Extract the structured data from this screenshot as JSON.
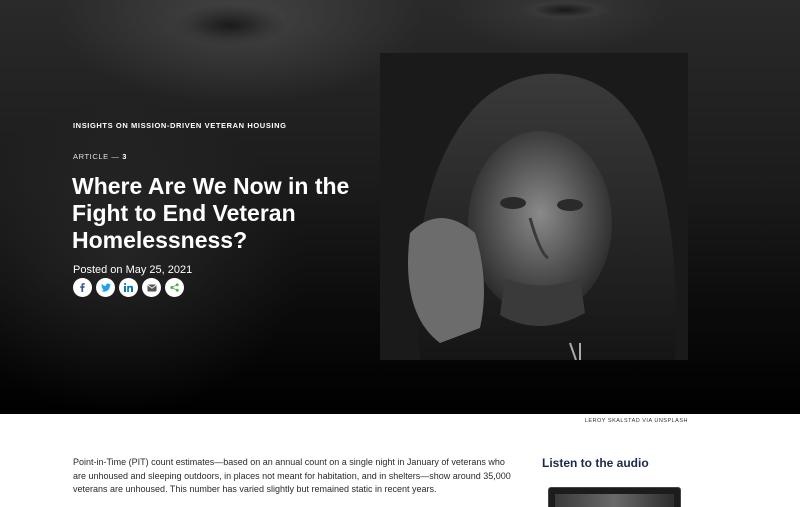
{
  "hero": {
    "kicker": "INSIGHTS ON MISSION-DRIVEN VETERAN HOUSING",
    "article_label": "ARTICLE —",
    "article_number": "3",
    "title": "Where Are We Now in the Fight to End Veteran Homelessness?",
    "posted": "Posted on May 25, 2021",
    "share_buttons": [
      {
        "icon": "facebook-icon",
        "color": "#3b5998"
      },
      {
        "icon": "twitter-icon",
        "color": "#1da1f2"
      },
      {
        "icon": "linkedin-icon",
        "color": "#0077b5"
      },
      {
        "icon": "email-icon",
        "color": "#555555"
      },
      {
        "icon": "share-icon",
        "color": "#4caf50"
      }
    ]
  },
  "photo": {
    "caption": "LEROY SKALSTAD VIA UNSPLASH"
  },
  "body": {
    "paragraph1": "Point-in-Time (PIT) count estimates—based on an annual count on a single night in January of veterans who are unhoused and sleeping outdoors, in places not meant for habitation, and in shelters—show around 35,000 veterans are unhoused. This number has varied slightly but remained static in recent years."
  },
  "sidebar": {
    "audio_heading": "Listen to the audio"
  }
}
